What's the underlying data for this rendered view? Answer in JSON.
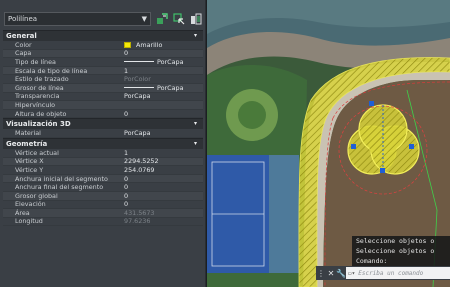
{
  "palette": {
    "object_type": "Polilínea",
    "sections": [
      {
        "title": "General",
        "rows": [
          {
            "label": "Color",
            "value": "Amarillo",
            "kind": "swatch"
          },
          {
            "label": "Capa",
            "value": "0"
          },
          {
            "label": "Tipo de línea",
            "value": "PorCapa",
            "kind": "line"
          },
          {
            "label": "Escala de tipo de línea",
            "value": "1"
          },
          {
            "label": "Estilo de trazado",
            "value": "PorColor",
            "kind": "dim"
          },
          {
            "label": "Grosor de línea",
            "value": "PorCapa",
            "kind": "line"
          },
          {
            "label": "Transparencia",
            "value": "PorCapa"
          },
          {
            "label": "Hipervínculo",
            "value": ""
          },
          {
            "label": "Altura de objeto",
            "value": "0"
          }
        ]
      },
      {
        "title": "Visualización 3D",
        "rows": [
          {
            "label": "Material",
            "value": "PorCapa"
          }
        ]
      },
      {
        "title": "Geometría",
        "rows": [
          {
            "label": "Vértice actual",
            "value": "1"
          },
          {
            "label": "Vértice X",
            "value": "2294.5252"
          },
          {
            "label": "Vértice Y",
            "value": "254.0769"
          },
          {
            "label": "Anchura inicial del segmento",
            "value": "0"
          },
          {
            "label": "Anchura final del segmento",
            "value": "0"
          },
          {
            "label": "Grosor global",
            "value": "0"
          },
          {
            "label": "Elevación",
            "value": "0"
          },
          {
            "label": "Área",
            "value": "431.5673",
            "kind": "dim"
          },
          {
            "label": "Longitud",
            "value": "97.6236",
            "kind": "dim"
          }
        ]
      }
    ],
    "colors": {
      "swatch": "#f5ea0a",
      "hatch": "#e4e02a",
      "grip": "#1f5fd6"
    }
  },
  "command": {
    "history": [
      "Seleccione objetos o",
      "Seleccione objetos o",
      "Comando:"
    ],
    "placeholder": "Escriba un comando",
    "icons": [
      "close-icon",
      "wrench-icon",
      "command-prompt-icon"
    ]
  }
}
